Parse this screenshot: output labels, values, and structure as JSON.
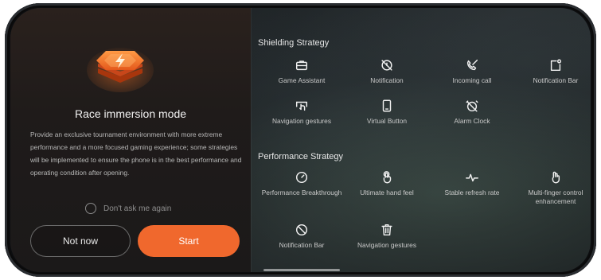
{
  "left": {
    "title": "Race immersion mode",
    "description": "Provide an exclusive tournament environment with more extreme performance and a more focused gaming experience; some strategies will be implemented to ensure the phone is in the best performance and operating condition after opening.",
    "dont_ask_label": "Don't ask  me again",
    "not_now_label": "Not now",
    "start_label": "Start"
  },
  "shielding": {
    "title": "Shielding Strategy",
    "items": [
      {
        "label": "Game Assistant",
        "icon": "briefcase-icon"
      },
      {
        "label": "Notification",
        "icon": "notification-off-icon"
      },
      {
        "label": "Incoming call",
        "icon": "phone-off-icon"
      },
      {
        "label": "Notification Bar",
        "icon": "notification-bar-icon"
      },
      {
        "label": "Navigation gestures",
        "icon": "gesture-icon"
      },
      {
        "label": "Virtual Button",
        "icon": "virtual-button-icon"
      },
      {
        "label": "Alarm Clock",
        "icon": "alarm-off-icon"
      }
    ]
  },
  "performance": {
    "title": "Performance Strategy",
    "items": [
      {
        "label": "Performance Breakthrough",
        "icon": "gauge-icon"
      },
      {
        "label": "Ultimate hand feel",
        "icon": "touch-icon"
      },
      {
        "label": "Stable refresh rate",
        "icon": "pulse-icon"
      },
      {
        "label": "Multi-finger control enhancement",
        "icon": "multi-touch-icon"
      },
      {
        "label": "Notification Bar",
        "icon": "block-icon"
      },
      {
        "label": "Navigation gestures",
        "icon": "trash-icon"
      }
    ]
  },
  "colors": {
    "accent": "#f0682d",
    "badge": "#f27a2e"
  }
}
